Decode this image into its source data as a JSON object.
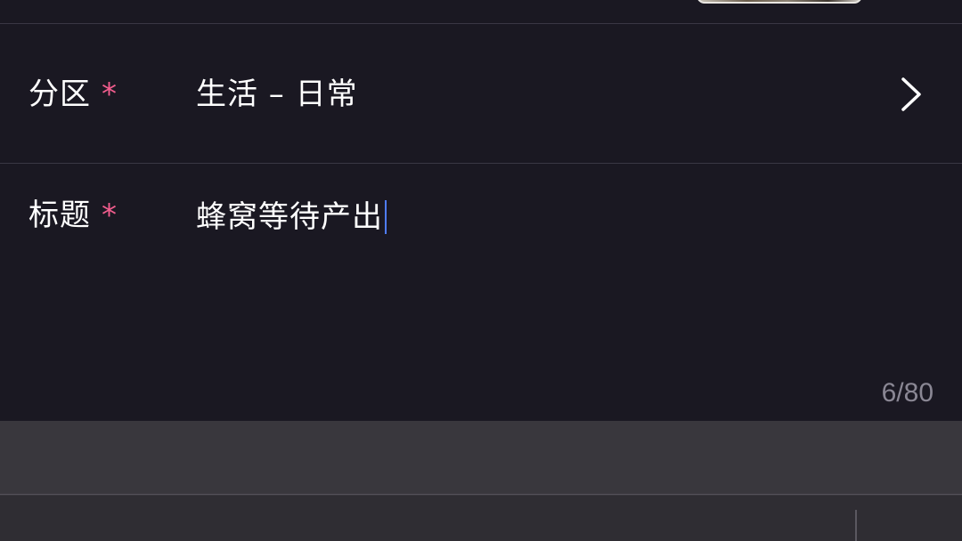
{
  "form": {
    "category": {
      "label": "分区",
      "required_mark": "*",
      "value": "生活 – 日常"
    },
    "title": {
      "label": "标题",
      "required_mark": "*",
      "value": "蜂窝等待产出",
      "char_count": "6/80"
    }
  },
  "icons": {
    "category_arrow": "chevron-right-icon",
    "cover": "cover-thumbnail"
  },
  "colors": {
    "background": "#1a1822",
    "required": "#f25d8e",
    "counter": "#8a8794",
    "keyboard": "#39373d",
    "caret": "#4f7cff"
  }
}
